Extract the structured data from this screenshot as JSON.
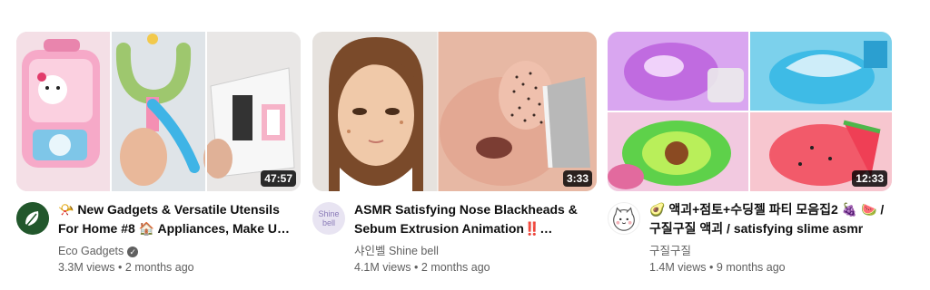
{
  "videos": [
    {
      "title": "📯 New Gadgets & Versatile Utensils For Home #8 🏠 Appliances, Make Up, Smart Inventions",
      "channel": "Eco Gadgets",
      "verified": true,
      "views": "3.3M views",
      "age": "2 months ago",
      "duration": "47:57",
      "separator": "•"
    },
    {
      "title": "ASMR Satisfying Nose Blackheads & Sebum Extrusion Animation‼️ Relaxing",
      "channel": "샤인벨 Shine bell",
      "avatar_text": "Shine bell",
      "views": "4.1M views",
      "age": "2 months ago",
      "duration": "3:33",
      "separator": "•"
    },
    {
      "title": "🥑 액괴+점토+수딩젤 파티 모음집2 🍇 🍉 / 구질구질 액괴 / satisfying slime asmr",
      "channel": "구질구질",
      "views": "1.4M views",
      "age": "9 months ago",
      "duration": "12:33",
      "separator": "•"
    }
  ],
  "colors": {
    "title": "#0f0f0f",
    "secondary": "#606060",
    "duration_bg": "#000000"
  }
}
